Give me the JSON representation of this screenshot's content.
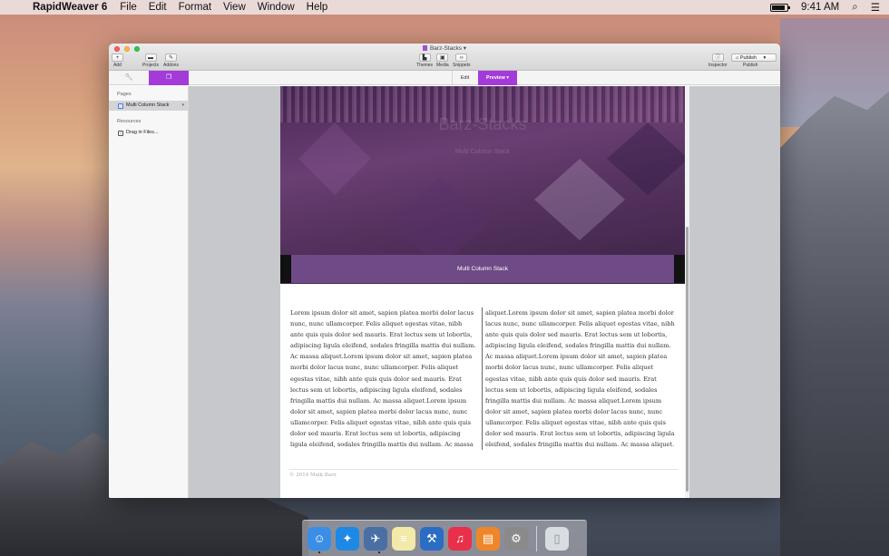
{
  "menubar": {
    "app_name": "RapidWeaver 6",
    "items": [
      "File",
      "Edit",
      "Format",
      "View",
      "Window",
      "Help"
    ],
    "clock": "9:41 AM",
    "battery_level": 0.85
  },
  "window": {
    "title": "Barz-Stacks",
    "toolbar_left": [
      {
        "label": "Add",
        "icon": "plus-icon"
      },
      {
        "label": "Projects",
        "icon": "projects-icon"
      },
      {
        "label": "Addons",
        "icon": "addons-icon"
      }
    ],
    "toolbar_center": [
      {
        "label": "Themes",
        "icon": "themes-icon"
      },
      {
        "label": "Media",
        "icon": "media-icon"
      },
      {
        "label": "Snippets",
        "icon": "snippets-icon"
      }
    ],
    "inspector_label": "Inspector",
    "publish_button": "Publish",
    "publish_caption": "Publish",
    "mode_edit": "Edit",
    "mode_preview": "Preview",
    "accent_color": "#a43bd9"
  },
  "sidebar": {
    "pages_heading": "Pages",
    "pages": [
      {
        "label": "Multi Column Stack",
        "selected": true
      }
    ],
    "resources_heading": "Resources",
    "resources": [
      {
        "label": "Drag in Files..."
      }
    ]
  },
  "preview": {
    "hero_title": "Barz-Stacks",
    "hero_subtitle": "Multi Column Stack",
    "banner_text": "Multi Column Stack",
    "col_left": "Lorem ipsum dolor sit amet, sapien platea morbi dolor lacus nunc, nunc ullamcorper. Felis aliquet egestas vitae, nibh ante quis quis dolor sed mauris. Erat lectus sem ut lobortis, adipiscing ligula eleifend, sodales fringilla mattis dui nullam. Ac massa aliquet.Lorem ipsum dolor sit amet, sapien platea morbi dolor lacus nunc, nunc ullamcorper. Felis aliquet egestas vitae, nibh ante quis quis dolor sed mauris. Erat lectus sem ut lobortis, adipiscing ligula eleifend, sodales fringilla mattis dui nullam. Ac massa aliquet.Lorem ipsum dolor sit amet, sapien platea morbi dolor lacus nunc, nunc ullamcorper. Felis aliquet egestas vitae, nibh ante quis quis dolor sed mauris. Erat lectus sem ut lobortis, adipiscing ligula eleifend, sodales fringilla mattis dui nullam. Ac massa",
    "col_right": "aliquet.Lorem ipsum dolor sit amet, sapien platea morbi dolor lacus nunc, nunc ullamcorper. Felis aliquet egestas vitae, nibh ante quis quis dolor sed mauris. Erat lectus sem ut lobortis, adipiscing ligula eleifend, sodales fringilla mattis dui nullam. Ac massa aliquet.Lorem ipsum dolor sit amet, sapien platea morbi dolor lacus nunc, nunc ullamcorper. Felis aliquet egestas vitae, nibh ante quis quis dolor sed mauris. Erat lectus sem ut lobortis, adipiscing ligula eleifend, sodales fringilla mattis dui nullam. Ac massa aliquet.Lorem ipsum dolor sit amet, sapien platea morbi dolor lacus nunc, nunc ullamcorper. Felis aliquet egestas vitae, nibh ante quis quis dolor sed mauris. Erat lectus sem ut lobortis, adipiscing ligula eleifend, sodales fringilla mattis dui nullam. Ac massa aliquet.",
    "footer": "© 2014 Malk Barz"
  },
  "dock": {
    "apps": [
      {
        "name": "finder-icon",
        "glyph": "☺",
        "color": "#3a8ee6"
      },
      {
        "name": "safari-icon",
        "glyph": "✦",
        "color": "#1e88e5"
      },
      {
        "name": "rapidweaver-icon",
        "glyph": "✈",
        "color": "#4a6fa5"
      },
      {
        "name": "notes-icon",
        "glyph": "≡",
        "color": "#f3e9a8"
      },
      {
        "name": "xcode-icon",
        "glyph": "⚒",
        "color": "#2b6cc4"
      },
      {
        "name": "itunes-icon",
        "glyph": "♫",
        "color": "#e8304a"
      },
      {
        "name": "ibooks-icon",
        "glyph": "▤",
        "color": "#f0862a"
      },
      {
        "name": "system-preferences-icon",
        "glyph": "⚙",
        "color": "#8a8a8a"
      }
    ],
    "trash": {
      "name": "trash-icon",
      "glyph": "▯",
      "color": "#d8dde2"
    }
  }
}
